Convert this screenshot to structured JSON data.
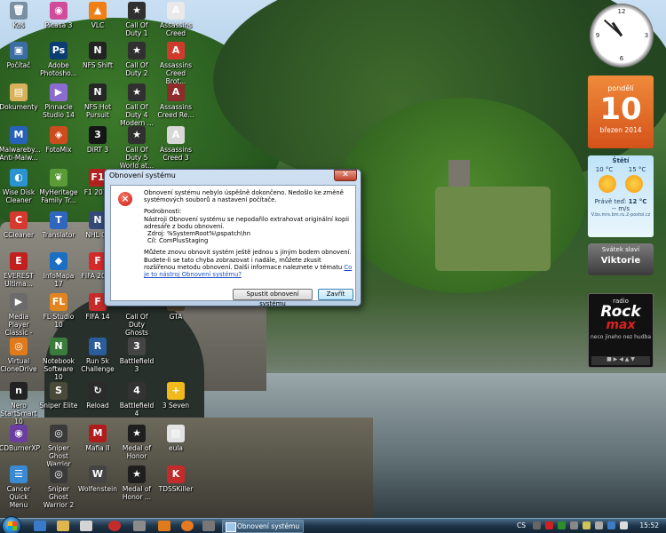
{
  "desktop": {
    "icons": [
      {
        "label": "Koš",
        "glyph": "🗑",
        "color": "#7b8fa3"
      },
      {
        "label": "Picasa 3",
        "glyph": "◉",
        "color": "#d24b9b"
      },
      {
        "label": "VLC",
        "glyph": "▲",
        "color": "#f07f16"
      },
      {
        "label": "Call Of Duty 1",
        "glyph": "★",
        "color": "#303030"
      },
      {
        "label": "Assassins Creed",
        "glyph": "A",
        "color": "#e9e9e9"
      },
      {
        "label": "Počítač",
        "glyph": "▣",
        "color": "#3b6da5"
      },
      {
        "label": "Adobe Photosho...",
        "glyph": "Ps",
        "color": "#0b3d73"
      },
      {
        "label": "NFS Shift",
        "glyph": "N",
        "color": "#222"
      },
      {
        "label": "Call Of Duty 2",
        "glyph": "★",
        "color": "#303030"
      },
      {
        "label": "Assassins Creed Brot...",
        "glyph": "A",
        "color": "#cf3a2c"
      },
      {
        "label": "Dokumenty",
        "glyph": "▤",
        "color": "#d8b25a"
      },
      {
        "label": "Pinnacle Studio 14",
        "glyph": "▶",
        "color": "#8c6bd1"
      },
      {
        "label": "NFS Hot Pursuit",
        "glyph": "N",
        "color": "#262626"
      },
      {
        "label": "Call Of Duty 4 Modern ...",
        "glyph": "★",
        "color": "#303030"
      },
      {
        "label": "Assassins Creed Re...",
        "glyph": "A",
        "color": "#8e2b2b"
      },
      {
        "label": "Malwareby... Anti-Malw...",
        "glyph": "M",
        "color": "#2862b8"
      },
      {
        "label": "FotoMix",
        "glyph": "◈",
        "color": "#cc4c1d"
      },
      {
        "label": "DiRT 3",
        "glyph": "3",
        "color": "#151515"
      },
      {
        "label": "Call Of Duty 5 World at...",
        "glyph": "★",
        "color": "#303030"
      },
      {
        "label": "Assassins Creed 3",
        "glyph": "A",
        "color": "#d8d8d8"
      },
      {
        "label": "Wise Disk Cleaner",
        "glyph": "◐",
        "color": "#2a93d0"
      },
      {
        "label": "MyHeritage Family Tr...",
        "glyph": "❦",
        "color": "#5b9b37"
      },
      {
        "label": "F1 2010",
        "glyph": "F1",
        "color": "#b32020"
      },
      {
        "label": "CCleaner",
        "glyph": "C",
        "color": "#d63a2f"
      },
      {
        "label": "Translator",
        "glyph": "T",
        "color": "#2f66c0"
      },
      {
        "label": "NHL 09",
        "glyph": "N",
        "color": "#364a7a"
      },
      {
        "label": "EVEREST Ultima...",
        "glyph": "E",
        "color": "#c21f1f"
      },
      {
        "label": "InfoMapa 17",
        "glyph": "◆",
        "color": "#1b6fc2"
      },
      {
        "label": "FIFA 2014",
        "glyph": "F",
        "color": "#d42a2a"
      },
      {
        "label": "Media Player Classic - H...",
        "glyph": "▶",
        "color": "#6b6b6b"
      },
      {
        "label": "FL Studio 10",
        "glyph": "FL",
        "color": "#e28420"
      },
      {
        "label": "FIFA 14",
        "glyph": "F",
        "color": "#c72b2b"
      },
      {
        "label": "Call Of Duty Ghosts",
        "glyph": "★",
        "color": "#303030"
      },
      {
        "label": "GTA",
        "glyph": "G",
        "color": "#5a4a2e"
      },
      {
        "label": "Virtual CloneDrive",
        "glyph": "◎",
        "color": "#e07a1a"
      },
      {
        "label": "Notebook Software 10",
        "glyph": "N",
        "color": "#3b7b3b"
      },
      {
        "label": "Run 5k Challenge",
        "glyph": "R",
        "color": "#2b5c9b"
      },
      {
        "label": "Battlefield 3",
        "glyph": "3",
        "color": "#444"
      },
      {
        "label": "Nero StartSmart 10",
        "glyph": "n",
        "color": "#222"
      },
      {
        "label": "Sniper Elite",
        "glyph": "S",
        "color": "#4a4a3a"
      },
      {
        "label": "Reload",
        "glyph": "↻",
        "color": "#2b2b2b"
      },
      {
        "label": "Battlefield 4",
        "glyph": "4",
        "color": "#333"
      },
      {
        "label": "3 Seven",
        "glyph": "+",
        "color": "#f0b91c"
      },
      {
        "label": "CDBurnerXP",
        "glyph": "◉",
        "color": "#6b3fa0"
      },
      {
        "label": "Sniper Ghost Warrior",
        "glyph": "◎",
        "color": "#3a3a3a"
      },
      {
        "label": "Mafia II",
        "glyph": "M",
        "color": "#b01c1c"
      },
      {
        "label": "Medal of Honor",
        "glyph": "★",
        "color": "#1f1f1f"
      },
      {
        "label": "eula",
        "glyph": "▤",
        "color": "#e3e3e3"
      },
      {
        "label": "Cancer Quick Menu",
        "glyph": "☰",
        "color": "#3a8ad3"
      },
      {
        "label": "Sniper Ghost Warrior 2",
        "glyph": "◎",
        "color": "#3a3a3a"
      },
      {
        "label": "Wolfenstein",
        "glyph": "W",
        "color": "#444"
      },
      {
        "label": "Medal of Honor ...",
        "glyph": "★",
        "color": "#1f1f1f"
      },
      {
        "label": "TDSSKiller",
        "glyph": "K",
        "color": "#c42b2b"
      }
    ]
  },
  "gadgets": {
    "clock": {
      "hour": 10,
      "minute": 52
    },
    "calendar": {
      "weekday": "pondělí",
      "day": "10",
      "month": "březen 2014"
    },
    "weather": {
      "title": "Štětí",
      "low": "10 °C",
      "high": "15 °C",
      "current_label": "Právě teď:",
      "current": "12 °C",
      "wind": "-- m/s",
      "source": "V.bs.mrs.bm.ru.2-postoi.cz"
    },
    "nameday": {
      "label": "Svátek slaví",
      "name": "Viktorie"
    },
    "radio": {
      "label": "radio",
      "brand1": "Rock",
      "brand2": "max",
      "tagline": "neco jineho nez hudba"
    }
  },
  "dialog": {
    "title": "Obnovení systému",
    "close_glyph": "✕",
    "message": "Obnovení systému nebylo úspěšně dokončeno. Nedošlo ke změně systémových souborů a nastavení počítače.",
    "details_heading": "Podrobnosti:",
    "details": "Nástroji Obnovení systému se nepodařilo extrahovat originální kopii adresáře z bodu obnovení.",
    "source": "Zdroj: %SystemRoot%\\pspatch\\hn",
    "target": "Cíl: ComPlusStaging",
    "hint": "Můžete znovu obnovit systém ještě jednou s jiným bodem obnovení. Budete-li se tato chyba zobrazovat i nadále, můžete zkusit rozšířenou metodu obnovení. Další informace naleznete v tématu",
    "link": "Co je to nástroj Obnovení systému?",
    "retry_button": "Spustit obnovení systému",
    "close_button": "Zavřít"
  },
  "taskbar": {
    "task_label": "Obnovení systému",
    "language": "CS",
    "time": "15:52"
  },
  "colors": {
    "accent": "#3c7fb1",
    "error": "#c31a0e",
    "calendar": "#e4661f"
  }
}
